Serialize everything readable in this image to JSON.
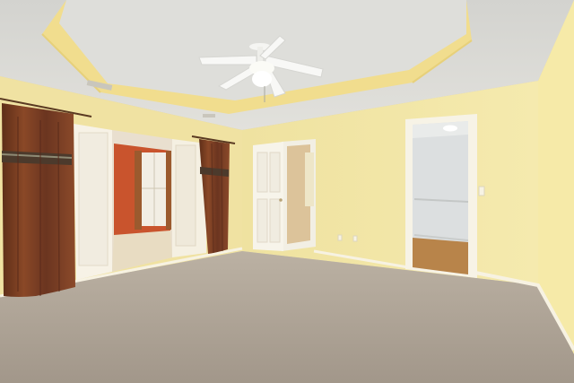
{
  "scene": {
    "description_shown": "",
    "colors": {
      "wall": "#f3e7a6",
      "ceiling": "#d9d9d4",
      "tray_band": "#f1dd8e",
      "carpet": "#a89d8f",
      "curtain": "#7a3f22",
      "accent_wall": "#c9542d",
      "door": "#f7f3e6",
      "wood_floor": "#b8844a",
      "closet_wall": "#dcdfe0"
    },
    "icons": [
      "ceiling-fan-icon",
      "air-vent-icon",
      "light-switch-icon",
      "outlet-icon"
    ]
  }
}
